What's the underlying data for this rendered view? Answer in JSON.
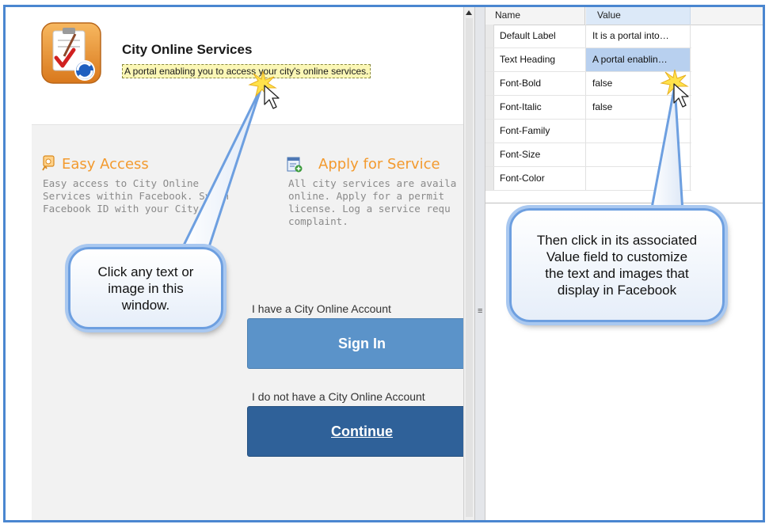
{
  "preview": {
    "title": "City Online Services",
    "subtitle": "A portal enabling you to access your city's online services.",
    "features": [
      {
        "title": "Easy Access",
        "icon": "key-icon",
        "body": "Easy access to City Online\nServices within Facebook. Synch\nFacebook ID with your City ID"
      },
      {
        "title": "Apply for Service",
        "icon": "form-add-icon",
        "body": "All city services are availa\nonline. Apply for a permit\nlicense. Log a service requ\ncomplaint."
      }
    ],
    "have_account_label": "I have a City Online Account",
    "sign_in_label": "Sign In",
    "no_account_label": "I do not have a City Online Account",
    "continue_label": "Continue"
  },
  "property_grid": {
    "columns": {
      "name": "Name",
      "value": "Value"
    },
    "rows": [
      {
        "name": "Default Label",
        "value": "It is a portal into…"
      },
      {
        "name": "Text Heading",
        "value": "A portal enablin…"
      },
      {
        "name": "Font-Bold",
        "value": "false"
      },
      {
        "name": "Font-Italic",
        "value": "false"
      },
      {
        "name": "Font-Family",
        "value": ""
      },
      {
        "name": "Font-Size",
        "value": ""
      },
      {
        "name": "Font-Color",
        "value": ""
      }
    ],
    "selected_row": 1
  },
  "callouts": {
    "left": "Click any text or\nimage in this\nwindow.",
    "right": "Then click in its associated\nValue field to customize\nthe text and images that\ndisplay in Facebook"
  },
  "colors": {
    "frame_border": "#4a86d0",
    "feature_title": "#f39a2e",
    "sign_in_button": "#5b93c9",
    "continue_button": "#2f6199",
    "callout_border": "#6d9fe0"
  }
}
